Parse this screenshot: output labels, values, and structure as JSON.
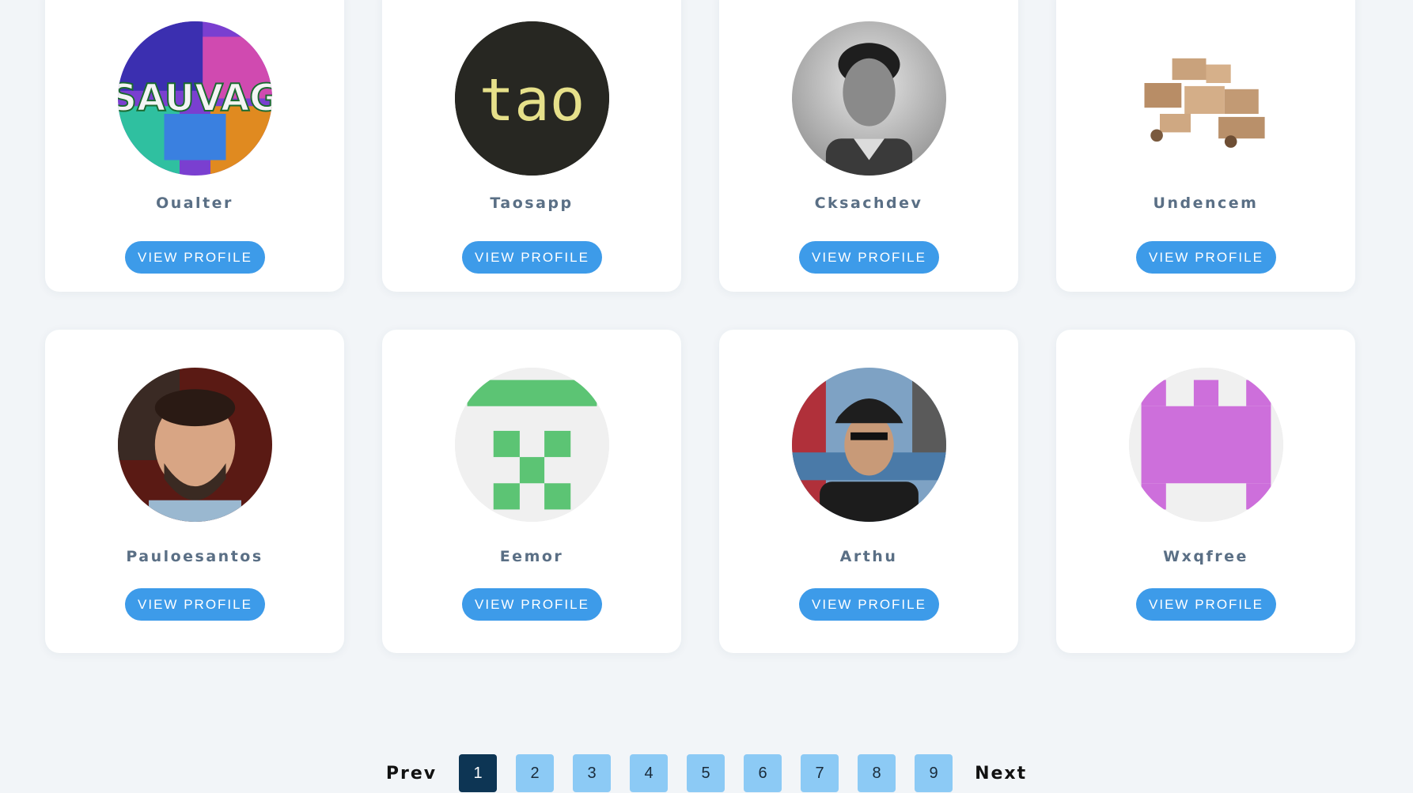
{
  "cards": [
    {
      "name": "Oualter",
      "button": "VIEW PROFILE",
      "avatar": "graffiti-photo"
    },
    {
      "name": "Taosapp",
      "button": "VIEW PROFILE",
      "avatar": "tao-logo"
    },
    {
      "name": "Cksachdev",
      "button": "VIEW PROFILE",
      "avatar": "portrait-photo"
    },
    {
      "name": "Undencem",
      "button": "VIEW PROFILE",
      "avatar": "boxes-photo"
    },
    {
      "name": "Pauloesantos",
      "button": "VIEW PROFILE",
      "avatar": "portrait-photo"
    },
    {
      "name": "Eemor",
      "button": "VIEW PROFILE",
      "avatar": "identicon-green"
    },
    {
      "name": "Arthu",
      "button": "VIEW PROFILE",
      "avatar": "portrait-photo-cap"
    },
    {
      "name": "Wxqfree",
      "button": "VIEW PROFILE",
      "avatar": "identicon-purple"
    }
  ],
  "tao_logo_text": "tao",
  "pagination": {
    "prev": "Prev",
    "next": "Next",
    "pages": [
      "1",
      "2",
      "3",
      "4",
      "5",
      "6",
      "7",
      "8",
      "9"
    ],
    "current": "1"
  },
  "colors": {
    "background": "#f2f5f8",
    "button": "#3d9be9",
    "username": "#5a6f85",
    "page_active": "#0d3554",
    "page_inactive": "#8ccaf5"
  }
}
